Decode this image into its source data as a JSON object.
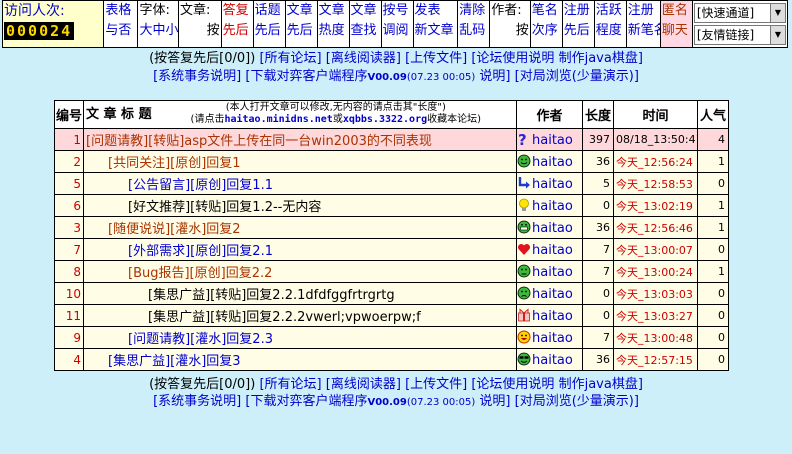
{
  "topbar": {
    "visitor_label": "访问人次:",
    "counter": "000024",
    "c1a": "表格",
    "c1b": "与否",
    "c2a": "字体:",
    "c2b": "大中小",
    "c3a": "文章:",
    "c3b": "按",
    "c4a": "答复",
    "c4b": "先后",
    "c5a": "话题",
    "c5b": "先后",
    "c6a": "文章",
    "c6b": "先后",
    "c7a": "文章",
    "c7b": "热度",
    "c8a": "文章",
    "c8b": "查找",
    "c9a": "按号",
    "c9b": "调阅",
    "c10a": "发表",
    "c10b": "新文章",
    "c11a": "清除",
    "c11b": "乱码",
    "c12a": "作者:",
    "c12b": "按",
    "c13a": "笔名",
    "c13b": "次序",
    "c14a": "注册",
    "c14b": "先后",
    "c15a": "活跃",
    "c15b": "程度",
    "c16a": "注册",
    "c16b": "新笔名",
    "c17a": "匿名",
    "c17b": "聊天",
    "select1": "[快速通道]",
    "select2": "[友情链接]"
  },
  "nav1": {
    "a": "(按答复先后[0/0])",
    "b": "[所有论坛]",
    "c": "[离线阅读器]",
    "d": "[上传文件]",
    "e": "[论坛使用说明",
    "f": "制作java棋盘]"
  },
  "nav2": {
    "a": "[系统事务说明]",
    "b": "[下载对弈客户端程序",
    "ver": "V00.09",
    "date": "(07.23 00:05)",
    "c": "说明]",
    "d": "[对局浏览(少量演示)]"
  },
  "table": {
    "h_num": "编号",
    "h_title": "文 章 标 题",
    "h_note1": "(本人打开文章可以修改,无内容的请点击其\"长度\")",
    "h_note2a": "(请点击",
    "h_note2b": "haitao.minidns.net",
    "h_note2c": "或",
    "h_note2d": "xqbbs.3322.org",
    "h_note2e": "收藏本论坛)",
    "h_author": "作者",
    "h_len": "长度",
    "h_time": "时间",
    "h_pop": "人气"
  },
  "rows": [
    {
      "num": "1",
      "tag": "[问题请教][转贴]",
      "topic": "asp文件上传在同一台win2003的不同表现",
      "author": "haitao",
      "icon": "question-icon",
      "len": "397",
      "time": "08/18_13:50:41",
      "pop": "4"
    },
    {
      "num": "2",
      "tag": "[共同关注][原创]",
      "topic": "回复1",
      "author": "haitao",
      "icon": "smiley-icon",
      "len": "36",
      "time": "今天_12:56:24",
      "pop": "1"
    },
    {
      "num": "5",
      "tag": "[公告留言][原创]",
      "topic": "回复1.1",
      "author": "haitao",
      "icon": "return-arrow-icon",
      "len": "5",
      "time": "今天_12:58:53",
      "pop": "0"
    },
    {
      "num": "6",
      "tag": "[好文推荐][转贴]",
      "topic": "回复1.2--无内容",
      "author": "haitao",
      "icon": "bulb-icon",
      "len": "0",
      "time": "今天_13:02:19",
      "pop": "1"
    },
    {
      "num": "3",
      "tag": "[随便说说][灌水]",
      "topic": "回复2",
      "author": "haitao",
      "icon": "grin-icon",
      "len": "36",
      "time": "今天_12:56:46",
      "pop": "1"
    },
    {
      "num": "7",
      "tag": "[外部需求][原创]",
      "topic": "回复2.1",
      "author": "haitao",
      "icon": "heart-icon",
      "len": "7",
      "time": "今天_13:00:07",
      "pop": "0"
    },
    {
      "num": "8",
      "tag": "[Bug报告][原创]",
      "topic": "回复2.2",
      "author": "haitao",
      "icon": "sad-icon",
      "len": "7",
      "time": "今天_13:00:24",
      "pop": "1"
    },
    {
      "num": "10",
      "tag": "[集思广益][转贴]",
      "topic": "回复2.2.1dfdfggfrtrgrtg",
      "author": "haitao",
      "icon": "frown-icon",
      "len": "0",
      "time": "今天_13:03:03",
      "pop": "0"
    },
    {
      "num": "11",
      "tag": "[集思广益][转贴]",
      "topic": "回复2.2.2vwerl;vpwoerpw;f",
      "author": "haitao",
      "icon": "gift-icon",
      "len": "0",
      "time": "今天_13:03:27",
      "pop": "0"
    },
    {
      "num": "9",
      "tag": "[问题请教][灌水]",
      "topic": "回复2.3",
      "author": "haitao",
      "icon": "laugh-icon",
      "len": "7",
      "time": "今天_13:00:48",
      "pop": "0"
    },
    {
      "num": "4",
      "tag": "[集思广益][灌水]",
      "topic": "回复3",
      "author": "haitao",
      "icon": "cool-icon",
      "len": "36",
      "time": "今天_12:57:15",
      "pop": "0"
    }
  ]
}
